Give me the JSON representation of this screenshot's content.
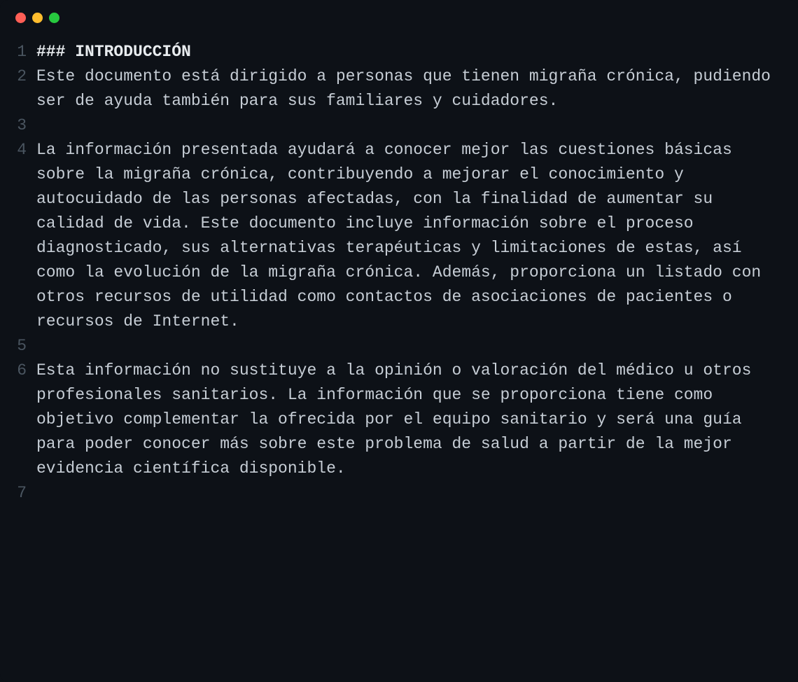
{
  "window": {
    "dots": [
      "red",
      "yellow",
      "green"
    ]
  },
  "lines": [
    {
      "num": "1",
      "text": "### INTRODUCCIÓN",
      "bold": true
    },
    {
      "num": "2",
      "text": "Este documento está dirigido a personas que tienen migraña crónica, pudiendo ser de ayuda también para sus familiares y cuidadores."
    },
    {
      "num": "3",
      "text": ""
    },
    {
      "num": "4",
      "text": "La información presentada ayudará a conocer mejor las cuestiones básicas sobre la migraña crónica, contribuyendo a mejorar el conocimiento y autocuidado de las personas afectadas, con la finalidad de aumentar su calidad de vida. Este documento incluye información sobre el proceso diagnosticado, sus alternativas terapéuticas y limitaciones de estas, así como la evolución de la migraña crónica. Además, proporciona un listado con otros recursos de utilidad como contactos de asociaciones de pacientes o recursos de Internet."
    },
    {
      "num": "5",
      "text": ""
    },
    {
      "num": "6",
      "text": "Esta información no sustituye a la opinión o valoración del médico u otros profesionales sanitarios. La información que se proporciona tiene como objetivo complementar la ofrecida por el equipo sanitario y será una guía para poder conocer más sobre este problema de salud a partir de la mejor evidencia científica disponible."
    },
    {
      "num": "7",
      "text": ""
    }
  ]
}
